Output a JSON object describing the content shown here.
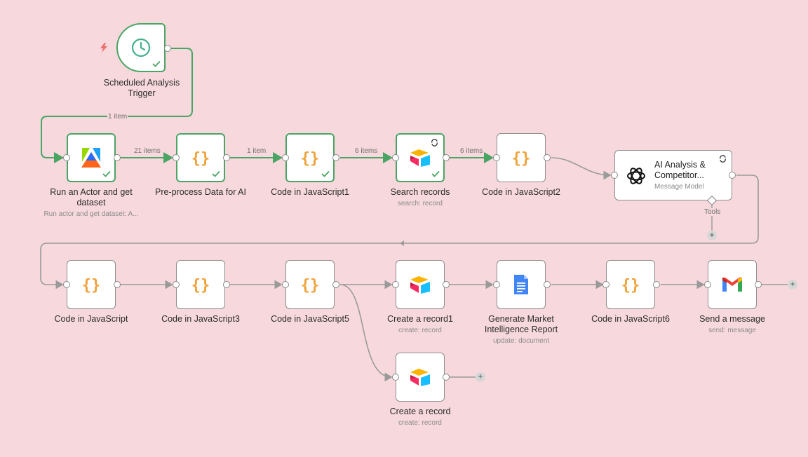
{
  "colors": {
    "background": "#f7d9dd",
    "success": "#4aa564",
    "js_orange": "#f0a23b",
    "connector": "#9a9a9a"
  },
  "nodes": {
    "trigger": {
      "label": "Scheduled Analysis Trigger",
      "icon": "clock-icon"
    },
    "actor": {
      "label": "Run an Actor and get dataset",
      "sub": "Run actor and get dataset: A...",
      "icon": "apify-icon"
    },
    "preprocess": {
      "label": "Pre-process Data for AI",
      "icon": "code-braces-icon"
    },
    "code1": {
      "label": "Code in JavaScript1",
      "icon": "code-braces-icon"
    },
    "search": {
      "label": "Search records",
      "sub": "search: record",
      "icon": "airtable-icon"
    },
    "code2": {
      "label": "Code in JavaScript2",
      "icon": "code-braces-icon"
    },
    "ai": {
      "title": "AI Analysis & Competitor...",
      "sub": "Message Model",
      "tools_label": "Tools",
      "icon": "openai-icon"
    },
    "code0": {
      "label": "Code in JavaScript",
      "icon": "code-braces-icon"
    },
    "code3": {
      "label": "Code in JavaScript3",
      "icon": "code-braces-icon"
    },
    "code5": {
      "label": "Code in JavaScript5",
      "icon": "code-braces-icon"
    },
    "create1": {
      "label": "Create a record1",
      "sub": "create: record",
      "icon": "airtable-icon"
    },
    "report": {
      "label": "Generate Market Intelligence Report",
      "sub": "update: document",
      "icon": "google-docs-icon"
    },
    "code6": {
      "label": "Code in JavaScript6",
      "icon": "code-braces-icon"
    },
    "gmail": {
      "label": "Send a message",
      "sub": "send: message",
      "icon": "gmail-icon"
    },
    "create": {
      "label": "Create a record",
      "sub": "create: record",
      "icon": "airtable-icon"
    }
  },
  "edges": {
    "trigger_to_actor": "1 item",
    "actor_to_preprocess": "21 items",
    "preprocess_to_code1": "1 item",
    "code1_to_search": "6 items",
    "search_to_code2": "6 items"
  },
  "add_symbol": "+"
}
